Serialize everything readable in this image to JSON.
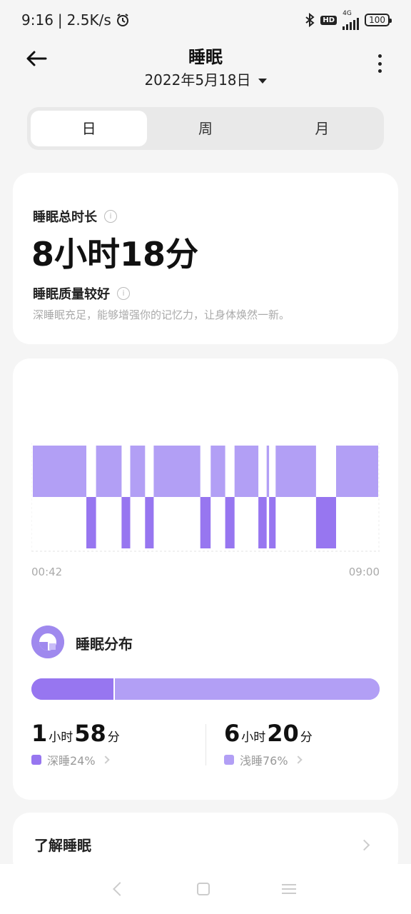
{
  "status": {
    "time": "9:16",
    "speed": "2.5K/s",
    "network": "4G",
    "battery": "100"
  },
  "header": {
    "title": "睡眠",
    "date": "2022年5月18日"
  },
  "tabs": [
    {
      "label": "日",
      "active": true
    },
    {
      "label": "周",
      "active": false
    },
    {
      "label": "月",
      "active": false
    }
  ],
  "summary": {
    "total_label": "睡眠总时长",
    "total_value": "8小时18分",
    "quality_label": "睡眠质量较好",
    "description": "深睡眠充足，能够增强你的记忆力，让身体焕然一新。"
  },
  "timeline": {
    "start": "00:42",
    "end": "09:00",
    "colors": {
      "light": "#b29ff5",
      "deep": "#9776f0"
    },
    "segments": [
      {
        "stage": "light",
        "from": 0.0,
        "to": 0.155
      },
      {
        "stage": "deep",
        "from": 0.155,
        "to": 0.183
      },
      {
        "stage": "light",
        "from": 0.183,
        "to": 0.257
      },
      {
        "stage": "deep",
        "from": 0.257,
        "to": 0.282
      },
      {
        "stage": "light",
        "from": 0.282,
        "to": 0.325
      },
      {
        "stage": "deep",
        "from": 0.325,
        "to": 0.35
      },
      {
        "stage": "light",
        "from": 0.35,
        "to": 0.485
      },
      {
        "stage": "deep",
        "from": 0.485,
        "to": 0.515
      },
      {
        "stage": "light",
        "from": 0.515,
        "to": 0.557
      },
      {
        "stage": "deep",
        "from": 0.557,
        "to": 0.584
      },
      {
        "stage": "light",
        "from": 0.584,
        "to": 0.653
      },
      {
        "stage": "deep",
        "from": 0.653,
        "to": 0.677
      },
      {
        "stage": "light",
        "from": 0.677,
        "to": 0.684
      },
      {
        "stage": "deep",
        "from": 0.684,
        "to": 0.703
      },
      {
        "stage": "light",
        "from": 0.703,
        "to": 0.82
      },
      {
        "stage": "deep",
        "from": 0.82,
        "to": 0.878
      },
      {
        "stage": "light",
        "from": 0.878,
        "to": 1.0
      }
    ]
  },
  "distribution": {
    "title": "睡眠分布",
    "deep_fraction": 0.24,
    "deep": {
      "hours": "1",
      "hours_unit": "小时",
      "minutes": "58",
      "minutes_unit": "分",
      "label": "深睡24%"
    },
    "light": {
      "hours": "6",
      "hours_unit": "小时",
      "minutes": "20",
      "minutes_unit": "分",
      "label": "浅睡76%"
    }
  },
  "learn": {
    "label": "了解睡眠"
  }
}
